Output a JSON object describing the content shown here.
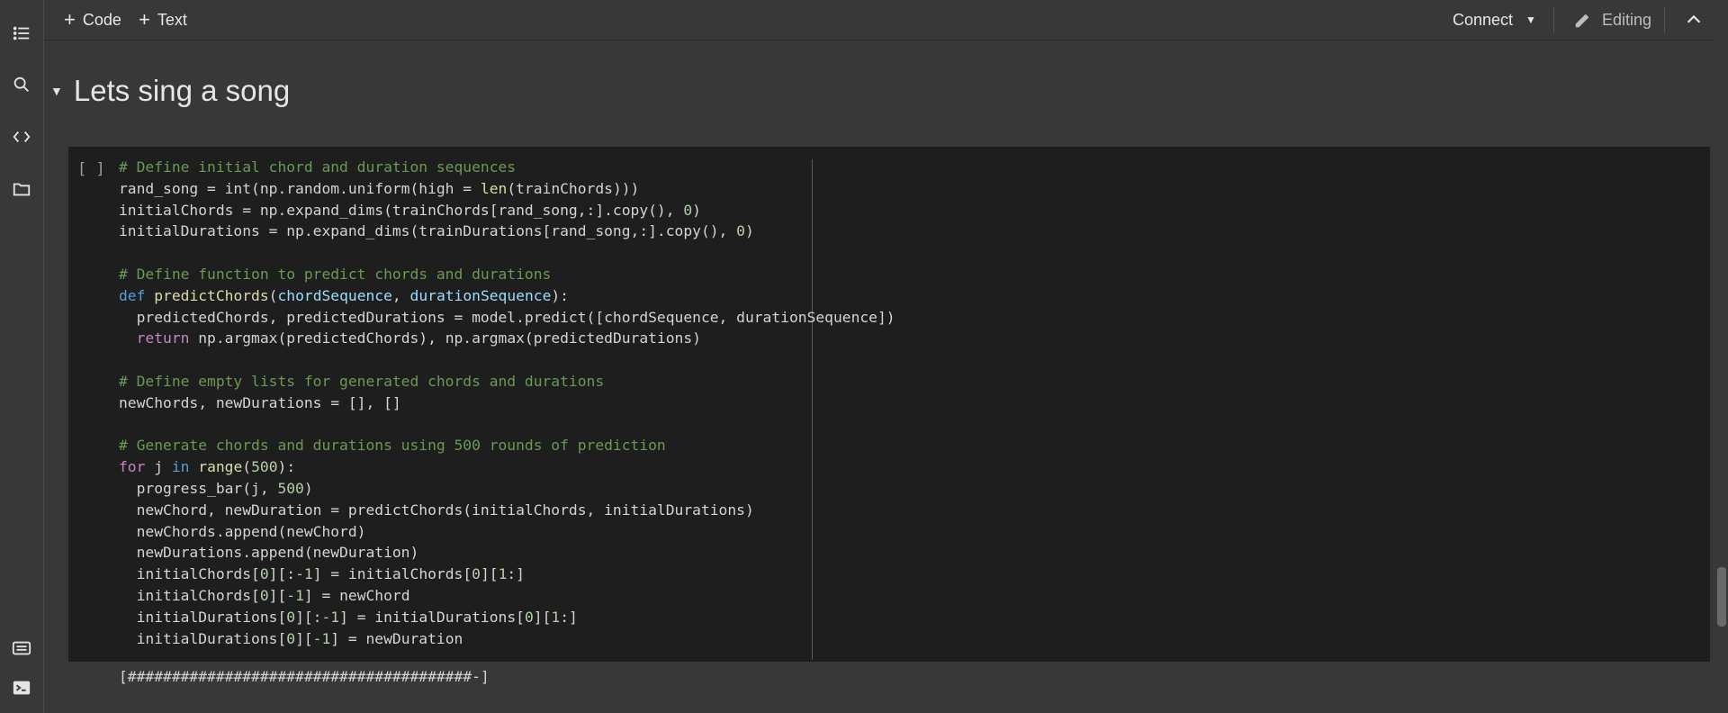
{
  "toolbar": {
    "add_code_label": "Code",
    "add_text_label": "Text",
    "connect_label": "Connect",
    "editing_label": "Editing"
  },
  "sidebar": {
    "icons": [
      "table-of-contents-icon",
      "search-icon",
      "code-snippets-icon",
      "files-icon",
      "command-palette-icon",
      "terminal-icon"
    ]
  },
  "section": {
    "title": "Lets sing a song"
  },
  "cell": {
    "run_indicator": "[ ]",
    "output": "[#######################################-]"
  }
}
